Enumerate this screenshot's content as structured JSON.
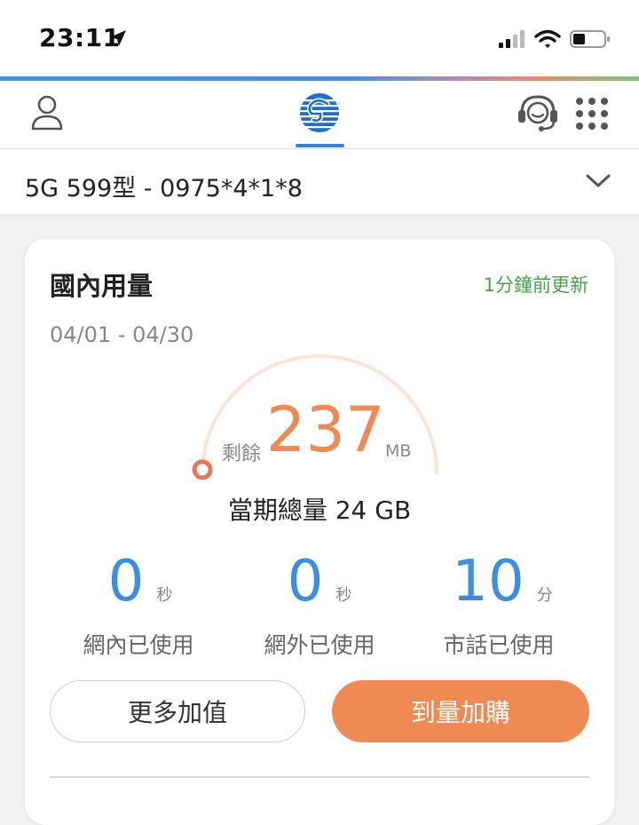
{
  "status_bar": {
    "time": "23:11",
    "icons": [
      "location-arrow-icon",
      "cellular-signal-icon",
      "wifi-icon",
      "battery-icon"
    ]
  },
  "header": {
    "icons": [
      "person-icon",
      "chunghwa-telecom-logo-icon",
      "customer-service-headset-icon",
      "app-grid-icon"
    ],
    "accent_color": "#3b82d6"
  },
  "plan": {
    "title": "5G 599型 - 0975*4*1*8",
    "icon": "chevron-down-icon"
  },
  "usage_card": {
    "title": "國內用量",
    "updated": "1分鐘前更新",
    "period": "04/01 - 04/30",
    "remaining_label": "剩餘",
    "remaining_value": "237",
    "remaining_unit": "MB",
    "remaining_fraction": 0.01,
    "total": "當期總量 24 GB",
    "accent_color": "#ef8a55",
    "stats": [
      {
        "value": "0",
        "unit": "秒",
        "label": "網內已使用"
      },
      {
        "value": "0",
        "unit": "秒",
        "label": "網外已使用"
      },
      {
        "value": "10",
        "unit": "分",
        "label": "市話已使用"
      }
    ],
    "buttons": {
      "more": "更多加值",
      "buy": "到量加購"
    }
  }
}
